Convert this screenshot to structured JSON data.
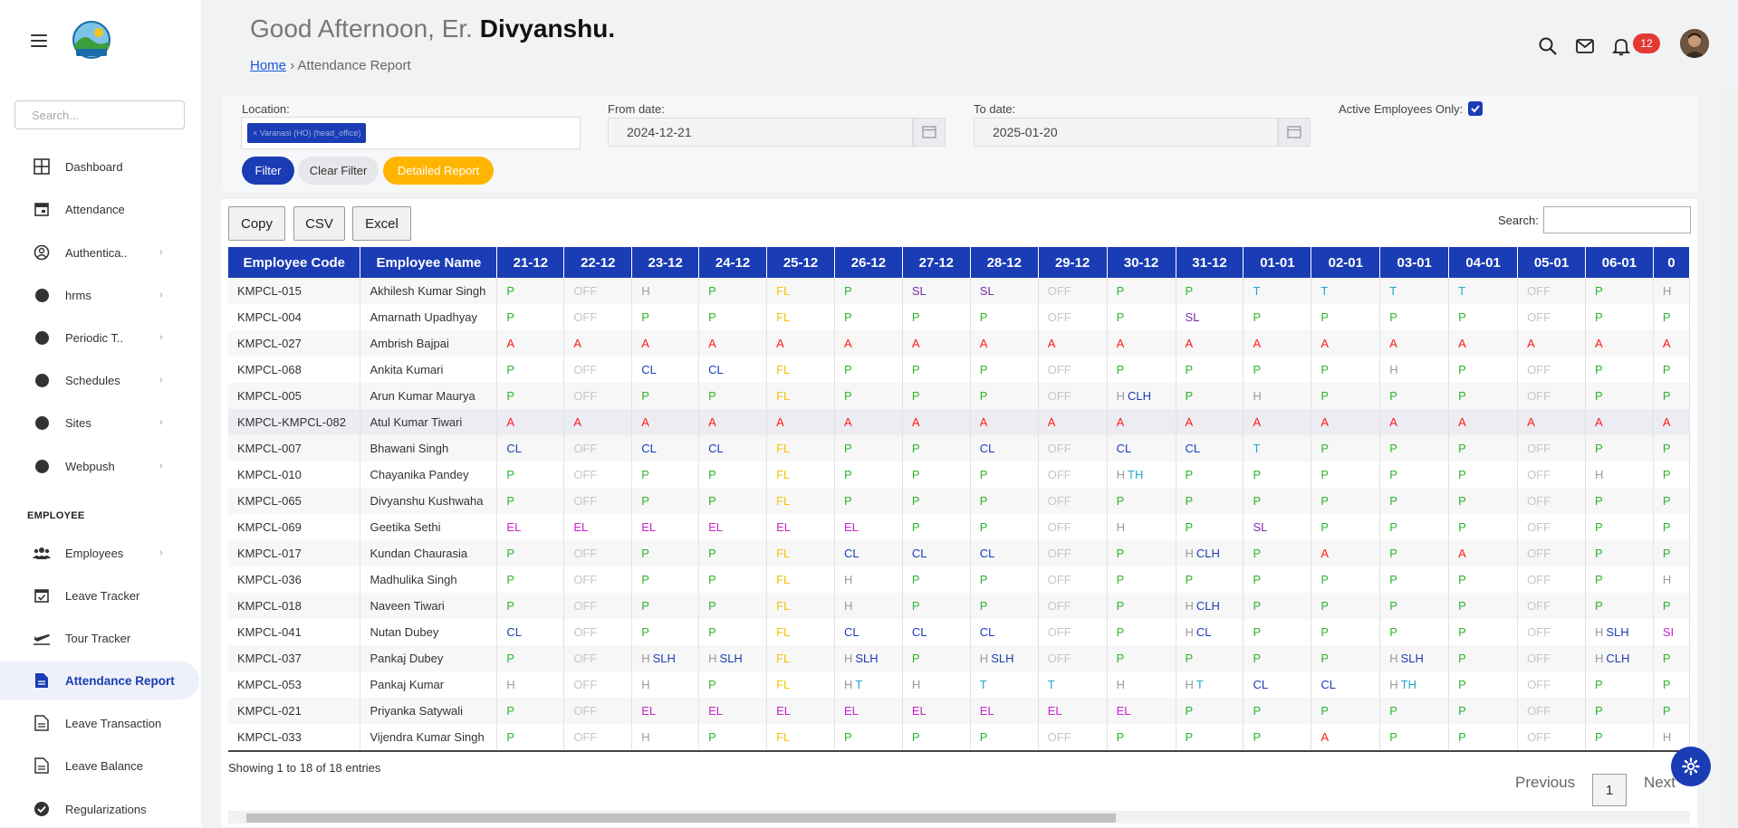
{
  "header": {
    "greeting_prefix": "Good Afternoon, Er. ",
    "greeting_name": "Divyanshu.",
    "breadcrumb_home": "Home",
    "breadcrumb_sep": "›",
    "breadcrumb_current": "Attendance Report",
    "notification_count": "12"
  },
  "sidebar": {
    "search_placeholder": "Search...",
    "items": [
      {
        "label": "Dashboard",
        "icon": "grid-icon"
      },
      {
        "label": "Attendance",
        "icon": "calendar-icon"
      },
      {
        "label": "Authentica..",
        "icon": "user-circle-icon",
        "chevron": "›"
      },
      {
        "label": "hrms",
        "icon": "dot-icon",
        "chevron": "›"
      },
      {
        "label": "Periodic T..",
        "icon": "dot-icon",
        "chevron": "›"
      },
      {
        "label": "Schedules",
        "icon": "dot-icon",
        "chevron": "›"
      },
      {
        "label": "Sites",
        "icon": "dot-icon",
        "chevron": "›"
      },
      {
        "label": "Webpush",
        "icon": "dot-icon",
        "chevron": "›"
      }
    ],
    "section_employee": "EMPLOYEE",
    "employee_items": [
      {
        "label": "Employees",
        "icon": "users-icon",
        "chevron": "›"
      },
      {
        "label": "Leave Tracker",
        "icon": "calendar-check-icon"
      },
      {
        "label": "Tour Tracker",
        "icon": "plane-icon"
      },
      {
        "label": "Attendance Report",
        "icon": "document-icon",
        "active": true
      },
      {
        "label": "Leave Transaction",
        "icon": "document-icon"
      },
      {
        "label": "Leave Balance",
        "icon": "document-icon"
      },
      {
        "label": "Regularizations",
        "icon": "check-circle-icon"
      }
    ]
  },
  "filters": {
    "location_label": "Location:",
    "location_chip": "× Varanasi (HO) (head_office)",
    "from_label": "From date:",
    "from_value": "2024-12-21",
    "to_label": "To date:",
    "to_value": "2025-01-20",
    "active_only_label": "Active Employees Only:",
    "active_only_checked": true,
    "filter_btn": "Filter",
    "clear_btn": "Clear Filter",
    "detailed_btn": "Detailed Report"
  },
  "table_tools": {
    "copy": "Copy",
    "csv": "CSV",
    "excel": "Excel",
    "search_label": "Search:"
  },
  "table": {
    "col_code": "Employee Code",
    "col_name": "Employee Name",
    "dates": [
      "21-12",
      "22-12",
      "23-12",
      "24-12",
      "25-12",
      "26-12",
      "27-12",
      "28-12",
      "29-12",
      "30-12",
      "31-12",
      "01-01",
      "02-01",
      "03-01",
      "04-01",
      "05-01",
      "06-01",
      "0"
    ],
    "rows": [
      {
        "code": "KMPCL-015",
        "name": "Akhilesh Kumar Singh",
        "s": [
          "P",
          "OFF",
          "H",
          "P",
          "FL",
          "P",
          "SL",
          "SL",
          "OFF",
          "P",
          "P",
          "T",
          "T",
          "T",
          "T",
          "OFF",
          "P",
          "H"
        ]
      },
      {
        "code": "KMPCL-004",
        "name": "Amarnath Upadhyay",
        "s": [
          "P",
          "OFF",
          "P",
          "P",
          "FL",
          "P",
          "P",
          "P",
          "OFF",
          "P",
          "SL",
          "P",
          "P",
          "P",
          "P",
          "OFF",
          "P",
          "P"
        ]
      },
      {
        "code": "KMPCL-027",
        "name": "Ambrish Bajpai",
        "s": [
          "A",
          "A",
          "A",
          "A",
          "A",
          "A",
          "A",
          "A",
          "A",
          "A",
          "A",
          "A",
          "A",
          "A",
          "A",
          "A",
          "A",
          "A"
        ]
      },
      {
        "code": "KMPCL-068",
        "name": "Ankita Kumari",
        "s": [
          "P",
          "OFF",
          "CL",
          "CL",
          "FL",
          "P",
          "P",
          "P",
          "OFF",
          "P",
          "P",
          "P",
          "P",
          "H",
          "P",
          "OFF",
          "P",
          "P"
        ]
      },
      {
        "code": "KMPCL-005",
        "name": "Arun Kumar Maurya",
        "s": [
          "P",
          "OFF",
          "P",
          "P",
          "FL",
          "P",
          "P",
          "P",
          "OFF",
          "H CLH",
          "P",
          "H",
          "P",
          "P",
          "P",
          "OFF",
          "P",
          "P"
        ]
      },
      {
        "code": "KMPCL-KMPCL-082",
        "name": "Atul Kumar Tiwari",
        "s": [
          "A",
          "A",
          "A",
          "A",
          "A",
          "A",
          "A",
          "A",
          "A",
          "A",
          "A",
          "A",
          "A",
          "A",
          "A",
          "A",
          "A",
          "A"
        ]
      },
      {
        "code": "KMPCL-007",
        "name": "Bhawani Singh",
        "s": [
          "CL",
          "OFF",
          "CL",
          "CL",
          "FL",
          "P",
          "P",
          "CL",
          "OFF",
          "CL",
          "CL",
          "T",
          "P",
          "P",
          "P",
          "OFF",
          "P",
          "P"
        ]
      },
      {
        "code": "KMPCL-010",
        "name": "Chayanika Pandey",
        "s": [
          "P",
          "OFF",
          "P",
          "P",
          "FL",
          "P",
          "P",
          "P",
          "OFF",
          "H TH",
          "P",
          "P",
          "P",
          "P",
          "P",
          "OFF",
          "H",
          "P"
        ]
      },
      {
        "code": "KMPCL-065",
        "name": "Divyanshu Kushwaha",
        "s": [
          "P",
          "OFF",
          "P",
          "P",
          "FL",
          "P",
          "P",
          "P",
          "OFF",
          "P",
          "P",
          "P",
          "P",
          "P",
          "P",
          "OFF",
          "P",
          "P"
        ]
      },
      {
        "code": "KMPCL-069",
        "name": "Geetika Sethi",
        "s": [
          "EL",
          "EL",
          "EL",
          "EL",
          "EL",
          "EL",
          "P",
          "P",
          "OFF",
          "H",
          "P",
          "SL",
          "P",
          "P",
          "P",
          "OFF",
          "P",
          "P"
        ]
      },
      {
        "code": "KMPCL-017",
        "name": "Kundan Chaurasia",
        "s": [
          "P",
          "OFF",
          "P",
          "P",
          "FL",
          "CL",
          "CL",
          "CL",
          "OFF",
          "P",
          "H CLH",
          "P",
          "A",
          "P",
          "A",
          "OFF",
          "P",
          "P"
        ]
      },
      {
        "code": "KMPCL-036",
        "name": "Madhulika Singh",
        "s": [
          "P",
          "OFF",
          "P",
          "P",
          "FL",
          "H",
          "P",
          "P",
          "OFF",
          "P",
          "P",
          "P",
          "P",
          "P",
          "P",
          "OFF",
          "P",
          "H"
        ]
      },
      {
        "code": "KMPCL-018",
        "name": "Naveen Tiwari",
        "s": [
          "P",
          "OFF",
          "P",
          "P",
          "FL",
          "H",
          "P",
          "P",
          "OFF",
          "P",
          "H CLH",
          "P",
          "P",
          "P",
          "P",
          "OFF",
          "P",
          "P"
        ]
      },
      {
        "code": "KMPCL-041",
        "name": "Nutan Dubey",
        "s": [
          "CL",
          "OFF",
          "P",
          "P",
          "FL",
          "CL",
          "CL",
          "CL",
          "OFF",
          "P",
          "H CL",
          "P",
          "P",
          "P",
          "P",
          "OFF",
          "H SLH",
          "SI"
        ]
      },
      {
        "code": "KMPCL-037",
        "name": "Pankaj Dubey",
        "s": [
          "P",
          "OFF",
          "H SLH",
          "H SLH",
          "FL",
          "H SLH",
          "P",
          "H SLH",
          "OFF",
          "P",
          "P",
          "P",
          "P",
          "H SLH",
          "P",
          "OFF",
          "H CLH",
          "P"
        ]
      },
      {
        "code": "KMPCL-053",
        "name": "Pankaj Kumar",
        "s": [
          "H",
          "OFF",
          "H",
          "P",
          "FL",
          "H T",
          "H",
          "T",
          "T",
          "H",
          "H T",
          "CL",
          "CL",
          "H TH",
          "P",
          "OFF",
          "P",
          "P"
        ]
      },
      {
        "code": "KMPCL-021",
        "name": "Priyanka Satywali",
        "s": [
          "P",
          "OFF",
          "EL",
          "EL",
          "EL",
          "EL",
          "EL",
          "EL",
          "EL",
          "EL",
          "P",
          "P",
          "P",
          "P",
          "P",
          "OFF",
          "P",
          "P"
        ]
      },
      {
        "code": "KMPCL-033",
        "name": "Vijendra Kumar Singh",
        "s": [
          "P",
          "OFF",
          "H",
          "P",
          "FL",
          "P",
          "P",
          "P",
          "OFF",
          "P",
          "P",
          "P",
          "A",
          "P",
          "P",
          "OFF",
          "P",
          "H"
        ]
      }
    ]
  },
  "footer": {
    "info": "Showing 1 to 18 of 18 entries",
    "previous": "Previous",
    "page": "1",
    "next": "Next"
  }
}
